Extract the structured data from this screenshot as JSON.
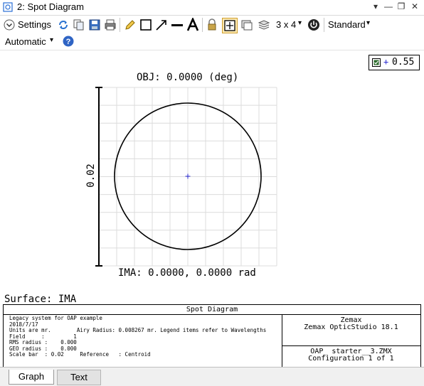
{
  "window": {
    "title": "2: Spot Diagram"
  },
  "toolbar": {
    "settings_label": "Settings",
    "layout_label": "3 x 4",
    "style_label": "Standard",
    "automatic_label": "Automatic"
  },
  "plot": {
    "obj_label": "OBJ: 0.0000 (deg)",
    "ima_label": "IMA: 0.0000, 0.0000 rad",
    "scale_label": "0.02",
    "surface_label": "Surface: IMA",
    "legend_value": "0.55"
  },
  "info": {
    "header": "Spot Diagram",
    "lines": [
      "Legacy system for OAP example",
      "2018/7/17",
      "Units are mr.        Airy Radius: 0.008267 mr. Legend items refer to Wavelengths",
      "Field     :         1",
      "RMS radius :    0.000",
      "GEO radius :    0.000",
      "Scale bar  : 0.02     Reference   : Centroid"
    ],
    "company": "Zemax",
    "product": "Zemax OpticStudio 18.1",
    "file": "OAP_ starter__3.ZMX",
    "config": "Configuration 1 of 1"
  },
  "tabs": [
    {
      "label": "Graph",
      "active": true
    },
    {
      "label": "Text",
      "active": false
    }
  ],
  "colors": {
    "accent": "#1f5fbf",
    "spot": "#2a2ad0"
  }
}
